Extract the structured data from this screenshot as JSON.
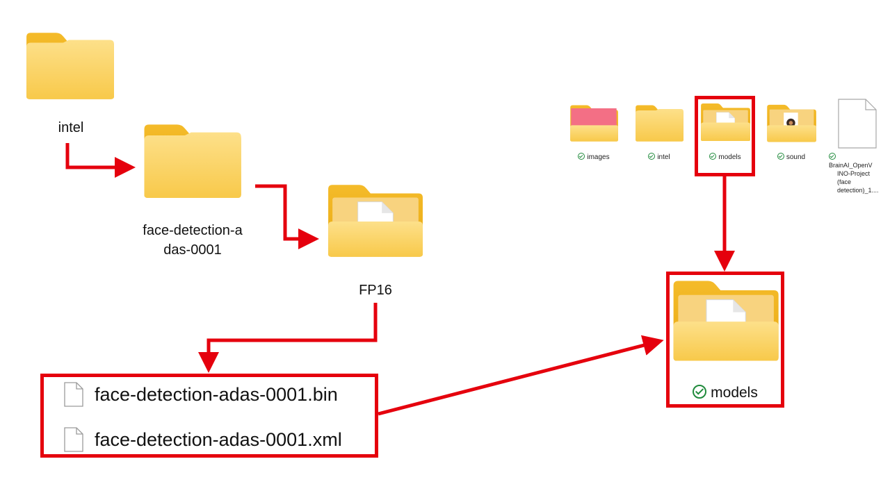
{
  "tree": {
    "intel_label": "intel",
    "face_detection_label_line1": "face-detection-a",
    "face_detection_label_line2": "das-0001",
    "fp16_label": "FP16"
  },
  "files": [
    {
      "name": "face-detection-adas-0001.bin"
    },
    {
      "name": "face-detection-adas-0001.xml"
    }
  ],
  "explorer": {
    "items": [
      {
        "name": "images"
      },
      {
        "name": "intel"
      },
      {
        "name": "models"
      },
      {
        "name": "sound"
      }
    ],
    "file_item": {
      "line1": "BrainAI_OpenV",
      "line2": "INO-Project",
      "line3": "(face",
      "line4": "detection)_1...."
    }
  },
  "models_zoom": {
    "label": "models"
  },
  "colors": {
    "arrow": "#e5000d",
    "folder_back": "#f2b520",
    "folder_front": "#fcd768",
    "sync": "#1f8a3b"
  }
}
